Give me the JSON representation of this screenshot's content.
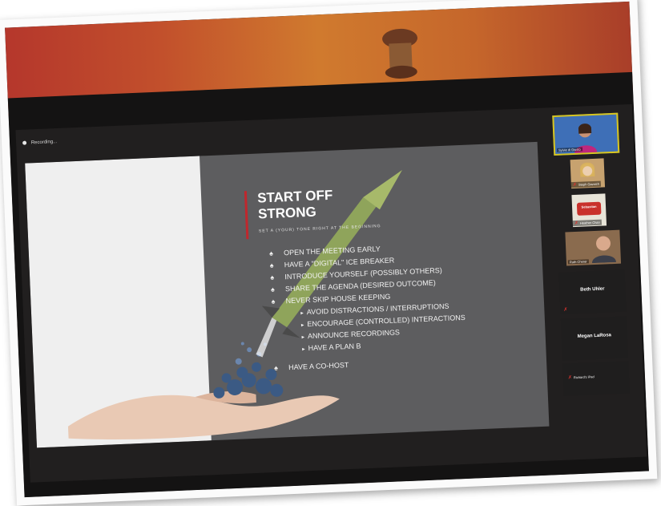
{
  "meeting": {
    "recording_label": "Recording..."
  },
  "slide": {
    "title_line1": "START OFF",
    "title_line2": "STRONG",
    "subtitle": "SET A (YOUR) TONE RIGHT AT THE BEGINNING",
    "bullets": [
      "OPEN THE MEETING EARLY",
      "HAVE A \"DIGITAL\" ICE BREAKER",
      "INTRODUCE YOURSELF (POSSIBLY OTHERS)",
      "SHARE THE AGENDA (DESIRED OUTCOME)",
      "NEVER SKIP HOUSE KEEPING"
    ],
    "sub_bullets": [
      "AVOID DISTRACTIONS / INTERRUPTIONS",
      "ENCOURAGE (CONTROLLED) INTERACTIONS",
      "ANNOUNCE RECORDINGS",
      "HAVE A PLAN B"
    ],
    "last_bullet": "HAVE A CO-HOST"
  },
  "gallery": {
    "participants": [
      {
        "name": "Sylvie di Giusto"
      },
      {
        "name": "Steph Gazsich"
      },
      {
        "name": "Heather Chan"
      },
      {
        "name": "Ruth Cherer"
      },
      {
        "name": "Beth Uhler"
      },
      {
        "name": "Megan LaRosa"
      },
      {
        "name": "Richard's iPad"
      }
    ],
    "logo_text": "Sebastian"
  },
  "colors": {
    "accent": "#c0272d",
    "active_speaker_border": "#d8c51e",
    "muted_icon": "#e0332e"
  }
}
